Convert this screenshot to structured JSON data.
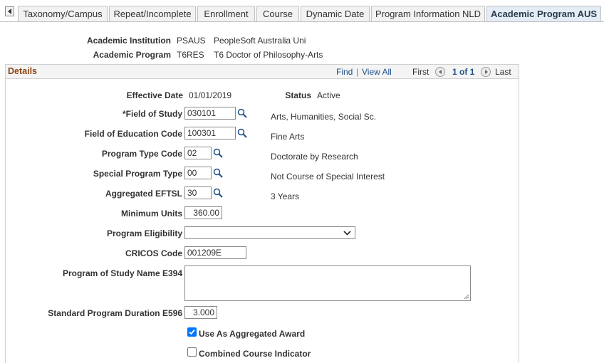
{
  "tabs": [
    {
      "label": "Taxonomy/Campus",
      "active": false
    },
    {
      "label": "Repeat/Incomplete",
      "active": false
    },
    {
      "label": "Enrollment",
      "active": false
    },
    {
      "label": "Course",
      "active": false
    },
    {
      "label": "Dynamic Date",
      "active": false
    },
    {
      "label": "Program Information NLD",
      "active": false
    },
    {
      "label": "Academic Program AUS",
      "active": true
    }
  ],
  "header": {
    "institution_label": "Academic Institution",
    "institution_code": "PSAUS",
    "institution_name": "PeopleSoft Australia Uni",
    "program_label": "Academic Program",
    "program_code": "T6RES",
    "program_name": "T6 Doctor of Philosophy-Arts"
  },
  "details": {
    "title": "Details",
    "find": "Find",
    "separator": "|",
    "view_all": "View All",
    "first": "First",
    "count": "1 of 1",
    "last": "Last"
  },
  "form": {
    "effective_date_label": "Effective Date",
    "effective_date": "01/01/2019",
    "status_label": "Status",
    "status": "Active",
    "field_of_study_label": "*Field of Study",
    "field_of_study": "030101",
    "field_of_study_desc": "Arts, Humanities, Social Sc.",
    "field_of_education_label": "Field of Education Code",
    "field_of_education": "100301",
    "field_of_education_desc": "Fine Arts",
    "program_type_label": "Program Type Code",
    "program_type": "02",
    "program_type_desc": "Doctorate by Research",
    "special_program_label": "Special Program Type",
    "special_program": "00",
    "special_program_desc": "Not Course of Special Interest",
    "eftsl_label": "Aggregated EFTSL",
    "eftsl": "30",
    "eftsl_desc": "3 Years",
    "min_units_label": "Minimum Units",
    "min_units": "360.00",
    "eligibility_label": "Program Eligibility",
    "eligibility": "",
    "cricos_label": "CRICOS Code",
    "cricos": "001209E",
    "study_name_label": "Program of Study Name E394",
    "study_name": "",
    "duration_label": "Standard Program Duration E596",
    "duration": "3.000",
    "aggregated_award_label": "Use As Aggregated Award",
    "aggregated_award_checked": true,
    "combined_course_label": "Combined Course Indicator",
    "combined_course_checked": false
  },
  "colors": {
    "accent": "#1f4f8a",
    "details_title": "#8b4513",
    "checkbox": "#0075ff"
  }
}
